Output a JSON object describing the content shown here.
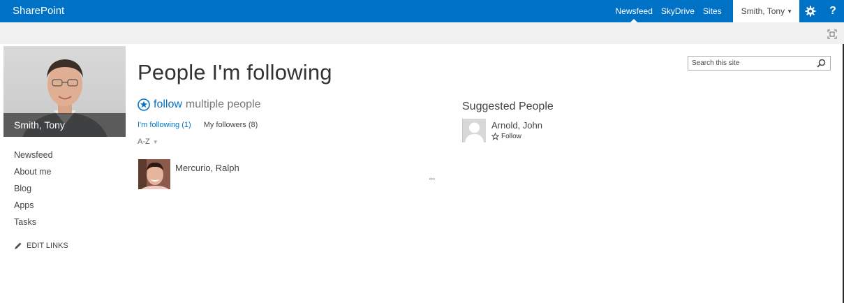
{
  "suite_bar": {
    "brand": "SharePoint",
    "nav": [
      "Newsfeed",
      "SkyDrive",
      "Sites"
    ],
    "active_nav": "Newsfeed",
    "user": "Smith, Tony",
    "help": "?",
    "color": "#0072c6"
  },
  "icons": {
    "settings": "gear-icon",
    "focus": "focus-on-content-icon",
    "follow_multiple": "follow-star-circle-icon",
    "follow_star": "star-outline-icon",
    "edit": "pencil-icon",
    "search": "search-icon"
  },
  "profile": {
    "name": "Smith, Tony"
  },
  "left_nav": {
    "items": [
      "Newsfeed",
      "About me",
      "Blog",
      "Apps",
      "Tasks"
    ],
    "edit_links": "EDIT LINKS"
  },
  "main": {
    "title": "People I'm following",
    "follow_word": "follow",
    "follow_rest": "multiple people",
    "tabs": [
      "I'm following (1)",
      "My followers (8)"
    ],
    "sort": "A-Z",
    "following": [
      {
        "name": "Mercurio, Ralph"
      }
    ],
    "ellipsis": "..."
  },
  "suggested": {
    "title": "Suggested People",
    "people": [
      {
        "name": "Arnold, John",
        "action": "Follow"
      }
    ]
  },
  "search": {
    "placeholder": "Search this site"
  }
}
